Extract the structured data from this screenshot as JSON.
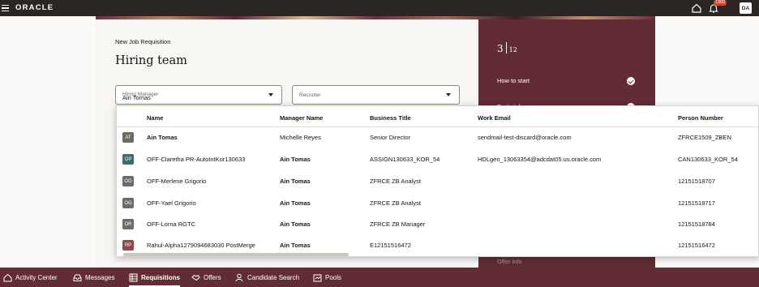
{
  "header": {
    "logo": "ORACLE",
    "notification_count": "1300",
    "avatar_initials": "DA"
  },
  "requisition": {
    "subtitle": "New Job Requisition",
    "title": "Hiring team",
    "hiring_manager": {
      "label": "Hiring Manager",
      "value": "Ain Tomas"
    },
    "recruiter": {
      "label": "Recruiter"
    }
  },
  "progress": {
    "current": "3",
    "total": "12",
    "steps": [
      {
        "label": "How to start",
        "done": true
      },
      {
        "label": "Basic info",
        "done": true
      },
      {
        "label": "Offer info",
        "done": false
      }
    ]
  },
  "dropdown": {
    "columns": [
      "Name",
      "Manager Name",
      "Business Title",
      "Work Email",
      "Person Number"
    ],
    "rows": [
      {
        "initials": "AT",
        "name": "Ain Tomas",
        "manager": "Michelle Reyes",
        "title": "Senior Director",
        "email": "sendmail-test-discard@oracle.com",
        "number": "ZFRCE1509_ZBEN"
      },
      {
        "initials": "OP",
        "name": "OFF-Claretha PR-AutoIntKor130633",
        "manager": "Ain Tomas",
        "title": "ASSIGN130633_KOR_54",
        "email": "HDLgen_13063354@adcdat05.us.oracle.com",
        "number": "CAN130633_KOR_54"
      },
      {
        "initials": "OG",
        "name": "OFF-Merlene Grigorio",
        "manager": "Ain Tomas",
        "title": "ZFRCE ZB Analyst",
        "email": "",
        "number": "12151518707"
      },
      {
        "initials": "OG",
        "name": "OFF-Yael Grigorio",
        "manager": "Ain Tomas",
        "title": "ZFRCE ZB Analyst",
        "email": "",
        "number": "12151518717"
      },
      {
        "initials": "OR",
        "name": "OFF-Lorna RGTC",
        "manager": "Ain Tomas",
        "title": "ZFRCE ZB Manager",
        "email": "",
        "number": "12151518784"
      },
      {
        "initials": "RP",
        "name": "Rahul-Alpha1279094683030 PostMerge",
        "manager": "Ain Tomas",
        "title": "E12151516472",
        "email": "",
        "number": "12151516472"
      }
    ]
  },
  "bottom_nav": [
    {
      "label": "Activity Center",
      "icon": "home-icon"
    },
    {
      "label": "Messages",
      "icon": "inbox-icon"
    },
    {
      "label": "Requisitions",
      "icon": "grid-icon",
      "active": true
    },
    {
      "label": "Offers",
      "icon": "handshake-icon"
    },
    {
      "label": "Candidate Search",
      "icon": "person-search-icon"
    },
    {
      "label": "Pools",
      "icon": "pool-icon"
    }
  ],
  "colors": {
    "brand_burgundy": "#612c34",
    "topbar": "#2b2624",
    "badge_red": "#c74634"
  }
}
